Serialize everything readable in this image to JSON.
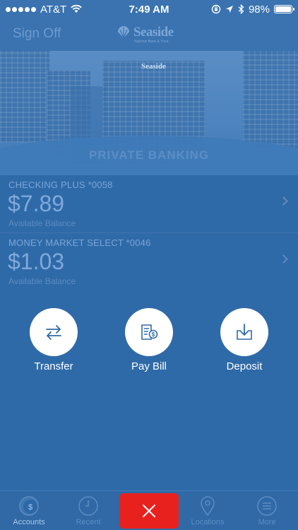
{
  "status_bar": {
    "carrier": "AT&T",
    "time": "7:49 AM",
    "battery": "98%",
    "battery_level": 0.98
  },
  "nav": {
    "sign_off": "Sign Off",
    "logo_text": "Seaside",
    "logo_subtext": "National Bank & Trust"
  },
  "hero": {
    "building_sign": "Seaside",
    "title": "PRIVATE BANKING"
  },
  "accounts": [
    {
      "name": "CHECKING PLUS *0058",
      "balance": "$7.89",
      "sub": "Available Balance"
    },
    {
      "name": "MONEY MARKET SELECT *0046",
      "balance": "$1.03",
      "sub": "Available Balance"
    }
  ],
  "actions": [
    {
      "label": "Transfer",
      "icon": "transfer-icon"
    },
    {
      "label": "Pay Bill",
      "icon": "pay-bill-icon"
    },
    {
      "label": "Deposit",
      "icon": "deposit-icon"
    }
  ],
  "tabs": [
    {
      "label": "Accounts",
      "icon": "accounts-icon",
      "active": true
    },
    {
      "label": "Recent",
      "icon": "clock-icon",
      "active": false
    },
    {
      "label": "Locations",
      "icon": "location-pin-icon",
      "active": false
    },
    {
      "label": "More",
      "icon": "more-icon",
      "active": false
    }
  ],
  "colors": {
    "background": "#2f6aa8",
    "close_button": "#e8211f",
    "action_circle": "#ffffff",
    "action_icon": "#2f6aa8"
  }
}
